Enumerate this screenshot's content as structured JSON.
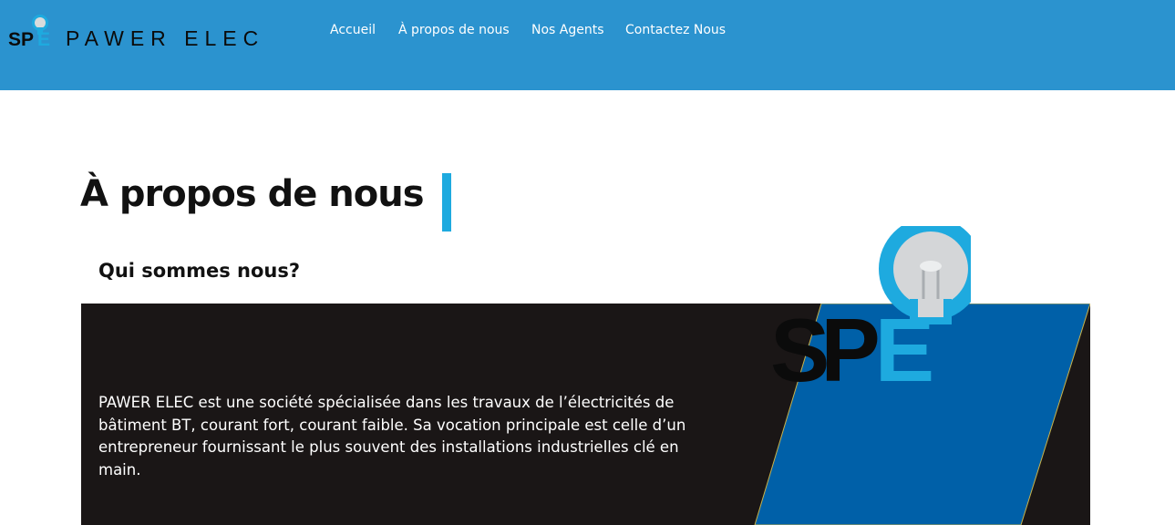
{
  "header": {
    "logo_mark": "SPE",
    "logo_text": "PAWER ELEC",
    "nav": [
      "Accueil",
      "À propos de nous",
      "Nos Agents",
      "Contactez Nous"
    ]
  },
  "main": {
    "title": "À propos de nous",
    "subtitle": "Qui sommes nous?",
    "body_text": "PAWER ELEC est une société spécialisée dans les travaux de l’électricités de bâtiment BT, courant fort, courant faible. Sa vocation principale est celle d’un entrepreneur fournissant le plus souvent des installations industrielles clé en main.",
    "illustration_text": "SPE"
  },
  "colors": {
    "header_bg": "#2b93cf",
    "accent": "#1eaadf",
    "panel_bg": "#1a1616",
    "parallelogram": "#0060a8"
  },
  "icons": [
    "lightbulb-icon"
  ]
}
